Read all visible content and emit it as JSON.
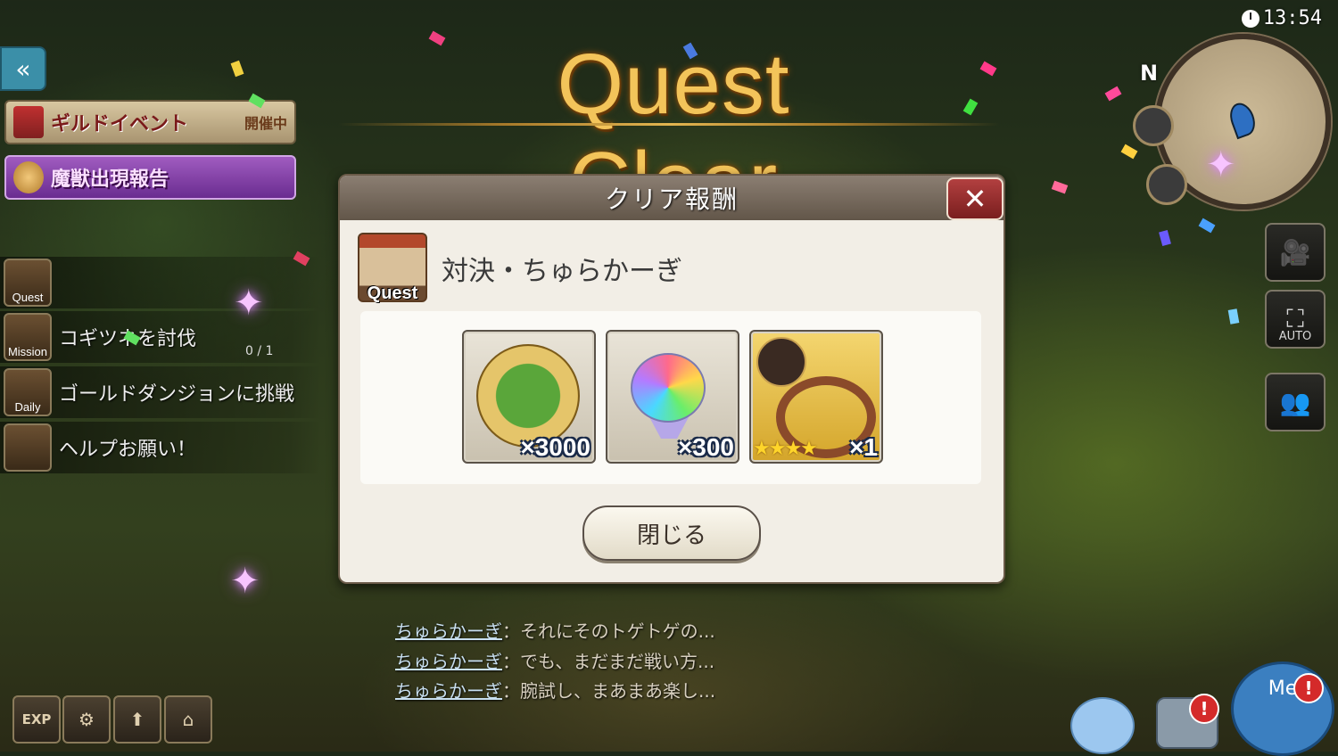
{
  "header": {
    "title": "Quest Clear",
    "clock": "13:54"
  },
  "minimap": {
    "north_label": "N"
  },
  "left_panel": {
    "guild_event": {
      "label": "ギルドイベント",
      "status": "開催中"
    },
    "beast_report": {
      "label": "魔獣出現報告"
    },
    "missions": [
      {
        "icon_label": "Quest",
        "text": "",
        "icon": "quest-icon"
      },
      {
        "icon_label": "Mission",
        "text": "コギツネを討伐",
        "count": "0 / 1",
        "icon": "fox-icon"
      },
      {
        "icon_label": "Daily",
        "text": "ゴールドダンジョンに挑戦",
        "icon": "daily-icon"
      },
      {
        "icon_label": "",
        "text": "ヘルプお願い！",
        "icon": "help-icon"
      }
    ]
  },
  "bottom_left": {
    "exp_label": "EXP"
  },
  "right_side": {
    "auto_label": "AUTO"
  },
  "dialog": {
    "title": "クリア報酬",
    "close_symbol": "✕",
    "quest_icon_label": "Quest",
    "quest_name": "対決・ちゅらかーぎ",
    "rewards": [
      {
        "name": "coin",
        "quantity": "×3000"
      },
      {
        "name": "rainbow-gem",
        "quantity": "×300"
      },
      {
        "name": "ring-equipment",
        "quantity": "×1",
        "stars": "★★★★"
      }
    ],
    "close_button": "閉じる"
  },
  "chat": [
    {
      "speaker": "ちゅらかーぎ",
      "message": "：それにそのトゲトゲの..."
    },
    {
      "speaker": "ちゅらかーぎ",
      "message": "：でも、まだまだ戦い方..."
    },
    {
      "speaker": "ちゅらかーぎ",
      "message": "：腕試し、まあまあ楽し..."
    }
  ],
  "bottom_right": {
    "me_label": "Me",
    "alert": "!"
  }
}
